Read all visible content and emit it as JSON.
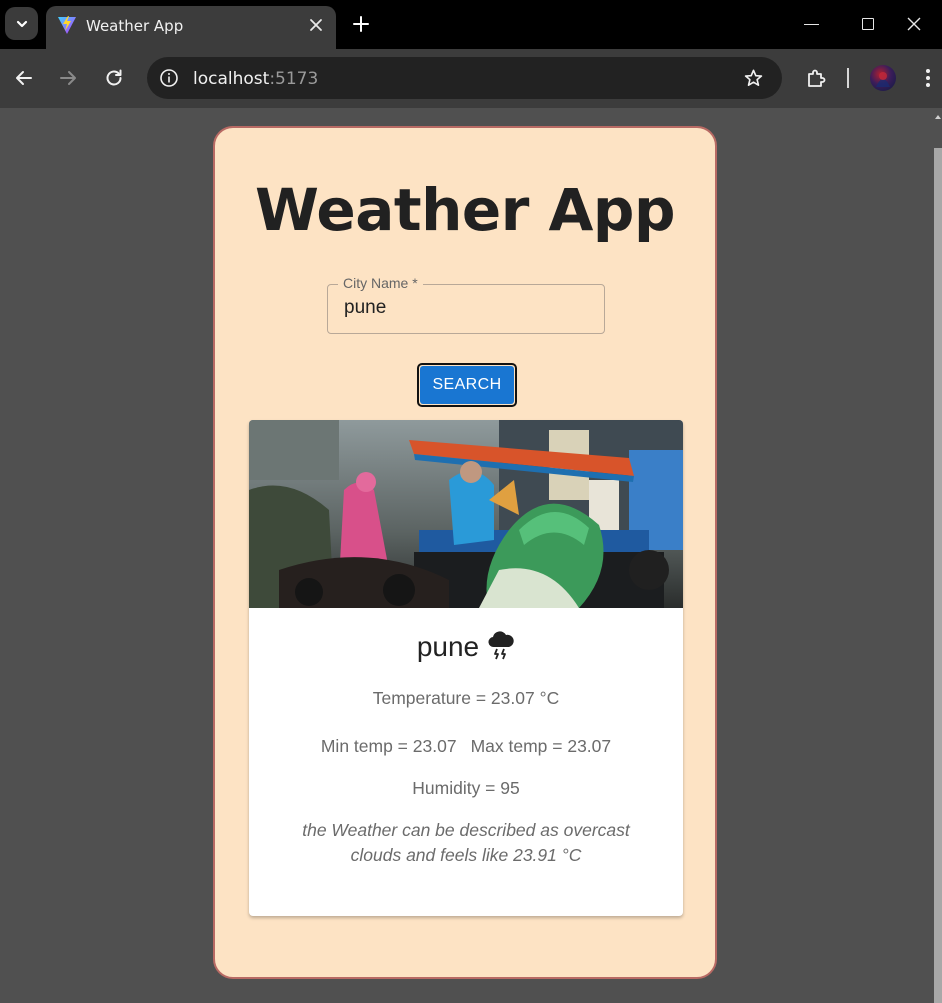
{
  "browser": {
    "tab_title": "Weather App",
    "url_host": "localhost",
    "url_port": ":5173"
  },
  "app": {
    "title": "Weather App",
    "city_field": {
      "label": "City Name *",
      "value": "pune"
    },
    "search_label": "SEARCH",
    "result": {
      "city": "pune",
      "weather_icon": "thunderstorm-cloud-icon",
      "temperature": "Temperature = 23.07 °C",
      "min_temp": "Min temp = 23.07",
      "max_temp": "Max temp = 23.07",
      "humidity": "Humidity = 95",
      "description": "the Weather can be described as overcast clouds and feels like 23.91 °C"
    }
  },
  "colors": {
    "card_background": "#fde3c4",
    "card_border": "#b86a64",
    "button": "#1976d2",
    "page_background": "#505050"
  }
}
